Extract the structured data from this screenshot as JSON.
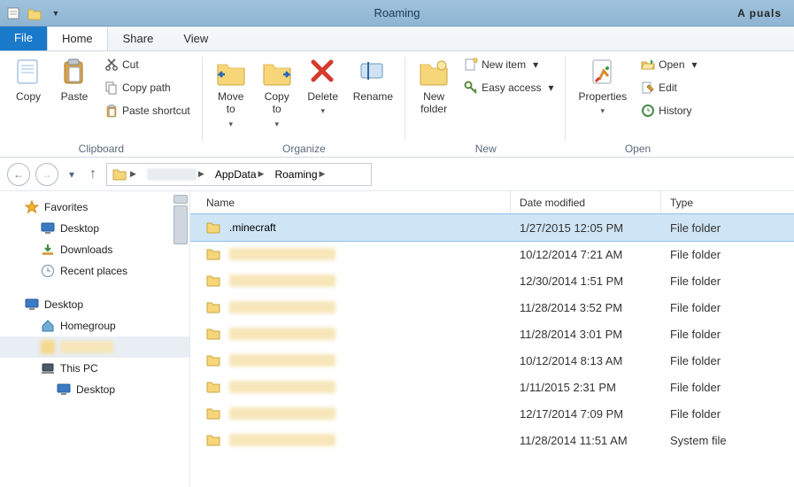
{
  "window": {
    "title": "Roaming"
  },
  "brand": {
    "text": "A   puals"
  },
  "tabs": {
    "file": "File",
    "items": [
      {
        "label": "Home",
        "active": true
      },
      {
        "label": "Share",
        "active": false
      },
      {
        "label": "View",
        "active": false
      }
    ]
  },
  "ribbon": {
    "clipboard": {
      "label": "Clipboard",
      "copy": "Copy",
      "paste": "Paste",
      "cut": "Cut",
      "copy_path": "Copy path",
      "paste_shortcut": "Paste shortcut"
    },
    "organize": {
      "label": "Organize",
      "move_to": "Move\nto",
      "copy_to": "Copy\nto",
      "delete": "Delete",
      "rename": "Rename"
    },
    "new": {
      "label": "New",
      "new_folder": "New\nfolder",
      "new_item": "New item",
      "easy_access": "Easy access"
    },
    "open": {
      "label": "Open",
      "properties": "Properties",
      "open": "Open",
      "edit": "Edit",
      "history": "History"
    }
  },
  "breadcrumb": {
    "segs": [
      "",
      "AppData",
      "Roaming"
    ]
  },
  "sidebar": {
    "favorites": "Favorites",
    "fav_items": [
      "Desktop",
      "Downloads",
      "Recent places"
    ],
    "desktop_root": "Desktop",
    "desktop_items": [
      "Homegroup",
      "",
      "This PC",
      "Desktop"
    ]
  },
  "columns": {
    "name": "Name",
    "date": "Date modified",
    "type": "Type"
  },
  "rows": [
    {
      "name": ".minecraft",
      "show_name": true,
      "date": "1/27/2015 12:05 PM",
      "type": "File folder",
      "selected": true
    },
    {
      "name": "",
      "show_name": false,
      "date": "10/12/2014 7:21 AM",
      "type": "File folder",
      "selected": false
    },
    {
      "name": "",
      "show_name": false,
      "date": "12/30/2014 1:51 PM",
      "type": "File folder",
      "selected": false
    },
    {
      "name": "",
      "show_name": false,
      "date": "11/28/2014 3:52 PM",
      "type": "File folder",
      "selected": false
    },
    {
      "name": "",
      "show_name": false,
      "date": "11/28/2014 3:01 PM",
      "type": "File folder",
      "selected": false
    },
    {
      "name": "",
      "show_name": false,
      "date": "10/12/2014 8:13 AM",
      "type": "File folder",
      "selected": false
    },
    {
      "name": "",
      "show_name": false,
      "date": "1/11/2015 2:31 PM",
      "type": "File folder",
      "selected": false
    },
    {
      "name": "",
      "show_name": false,
      "date": "12/17/2014 7:09 PM",
      "type": "File folder",
      "selected": false
    },
    {
      "name": "",
      "show_name": false,
      "date": "11/28/2014 11:51 AM",
      "type": "System file",
      "selected": false
    }
  ]
}
